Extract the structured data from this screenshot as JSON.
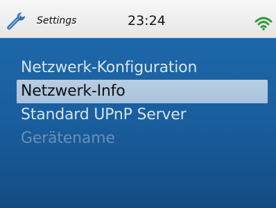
{
  "status_bar": {
    "app_icon": "wrench-icon",
    "app_title": "Settings",
    "time": "23:24",
    "signal_icon": "wifi-icon",
    "signal_color": "#2f9a3a"
  },
  "menu": {
    "items": [
      {
        "label": "Netzwerk-Konfiguration",
        "state": "normal"
      },
      {
        "label": "Netzwerk-Info",
        "state": "selected"
      },
      {
        "label": "Standard UPnP Server",
        "state": "normal"
      },
      {
        "label": "Gerätename",
        "state": "disabled"
      }
    ]
  },
  "colors": {
    "background_top": "#1d67a8",
    "background_bottom": "#134c83",
    "selection": "#b7cde3",
    "text_normal": "#d6e3ef",
    "text_disabled": "#6a8fb6"
  }
}
